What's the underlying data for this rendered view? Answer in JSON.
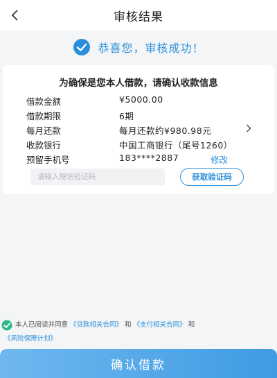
{
  "nav": {
    "title": "审核结果",
    "back_icon": "chevron-left-icon"
  },
  "banner": {
    "message": "恭喜您，审核成功！",
    "icon": "check-circle-icon"
  },
  "card": {
    "title": "为确保是您本人借款，请确认收款信息",
    "rows": [
      {
        "label": "借款金额",
        "value": "¥5000.00"
      },
      {
        "label": "借款期限",
        "value": "6期"
      },
      {
        "label": "每月还款",
        "value": "每月还款约¥980.98元"
      },
      {
        "label": "收款银行",
        "value": "中国工商银行（尾号1260）"
      },
      {
        "label": "预留手机号",
        "value": "183****2887",
        "action": "修改"
      }
    ],
    "sms_placeholder": "请输入短信验证码",
    "sms_value": "",
    "get_code_label": "获取验证码"
  },
  "agreement": {
    "prefix": "本人已阅读并同意",
    "link1": "《贷款相关合同》",
    "and1": "和",
    "link2": "《支付相关合同》",
    "and2": "和",
    "link3": "《风险保障计划》"
  },
  "submit_label": "确认借款",
  "colors": {
    "accent": "#2a8fd8",
    "success_green": "#2fb986",
    "page_bg": "#f4f5f7"
  }
}
